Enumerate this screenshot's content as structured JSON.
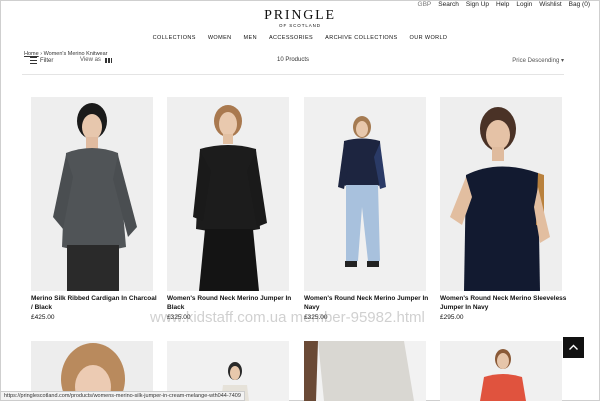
{
  "utility": {
    "currency": "GBP",
    "search": "Search",
    "signup": "Sign Up",
    "help": "Help",
    "login": "Login",
    "wishlist": "Wishlist",
    "bag": "Bag (0)"
  },
  "brand": {
    "name": "PRINGLE",
    "sub": "OF SCOTLAND"
  },
  "nav": [
    "COLLECTIONS",
    "WOMEN",
    "MEN",
    "ACCESSORIES",
    "ARCHIVE COLLECTIONS",
    "OUR WORLD"
  ],
  "breadcrumb": {
    "home": "Home",
    "sep": "›",
    "current": "Women's Merino Knitwear"
  },
  "toolbar": {
    "filter": "Filter",
    "view": "View as",
    "count": "10 Products",
    "sort": "Price Descending"
  },
  "products": [
    {
      "name": "Merino Silk Ribbed Cardigan In Charcoal / Black",
      "price": "£425.00"
    },
    {
      "name": "Women's Round Neck Merino Jumper In Black",
      "price": "£325.00"
    },
    {
      "name": "Women's Round Neck Merino Jumper In Navy",
      "price": "£325.00"
    },
    {
      "name": "Women's Round Neck Merino Sleeveless Jumper In Navy",
      "price": "£295.00"
    }
  ],
  "watermark": "www.kidstaff.com.ua member-95982.html",
  "status_url": "https://pringlescotland.com/products/womens-merino-silk-jumper-in-cream-melange-wth044-7409"
}
